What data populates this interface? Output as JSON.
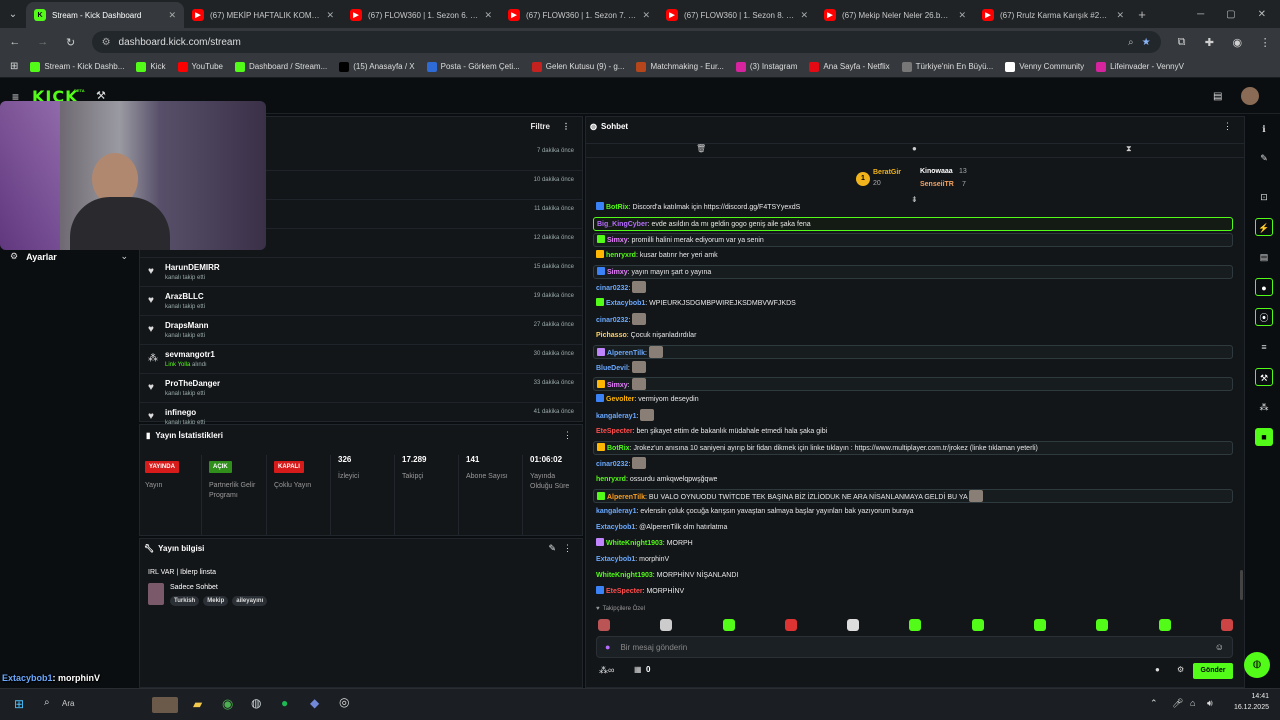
{
  "browser": {
    "tabs": [
      {
        "title": "Stream - Kick Dashboard",
        "icon": "kick-icon",
        "active": true
      },
      {
        "title": "(67) MEKİP HAFTALIK KOMİK AN",
        "icon": "youtube-icon"
      },
      {
        "title": "(67) FLOW360 | 1. Sezon 6. Bölü",
        "icon": "youtube-icon"
      },
      {
        "title": "(67) FLOW360 | 1. Sezon 7. Bölü",
        "icon": "youtube-icon"
      },
      {
        "title": "(67) FLOW360 | 1. Sezon 8. Bölü",
        "icon": "youtube-icon"
      },
      {
        "title": "(67) Mekip Neler Neler 26.bölüm",
        "icon": "youtube-icon"
      },
      {
        "title": "(67) Rrulz Karma Karışık #21 - Y",
        "icon": "youtube-icon"
      }
    ],
    "url": "dashboard.kick.com/stream",
    "bookmarks": [
      "Stream - Kick Dashb...",
      "Kick",
      "YouTube",
      "Dashboard / Stream...",
      "(15) Anasayfa / X",
      "Posta - Görkem Çeti...",
      "Gelen Kutusu (9) - g...",
      "Matchmaking - Eur...",
      "(3) Instagram",
      "Ana Sayfa - Netflix",
      "Türkiye'nin En Büyü...",
      "Venny Community",
      "Lifeinvader - VennyV"
    ]
  },
  "kick": {
    "logo": "KICK",
    "beta": "BETA"
  },
  "sidebar": {
    "settings": "Ayarlar"
  },
  "feed": {
    "filter": "Filtre",
    "rows": [
      {
        "time": "7 dakika önce"
      },
      {
        "time": "10 dakika önce"
      },
      {
        "time": "11 dakika önce"
      },
      {
        "time": "12 dakika önce"
      },
      {
        "name": "HarunDEMIRR",
        "sub": "kanalı takip etti",
        "time": "15 dakika önce"
      },
      {
        "name": "ArazBLLC",
        "sub": "kanalı takip etti",
        "time": "19 dakika önce"
      },
      {
        "name": "DrapsMann",
        "sub": "kanalı takip etti",
        "time": "27 dakika önce"
      },
      {
        "name": "sevmangotr1",
        "sub_link": "Link Yolla",
        "sub": "alındı",
        "time": "30 dakika önce"
      },
      {
        "name": "ProTheDanger",
        "sub": "kanalı takip etti",
        "time": "33 dakika önce"
      },
      {
        "name": "infinego",
        "sub": "kanalı takip etti",
        "time": "41 dakika önce"
      }
    ]
  },
  "stats": {
    "title": "Yayın İstatistikleri",
    "items": [
      {
        "badge": "YAYINDA",
        "badge_color": "#d71a1a",
        "label": "Yayın"
      },
      {
        "badge": "AÇIK",
        "badge_color": "#2f8f1a",
        "label": "Partnerlik Gelir Programı"
      },
      {
        "badge": "KAPALI",
        "badge_color": "#d71a1a",
        "label": "Çoklu Yayın"
      },
      {
        "value": "326",
        "label": "İzleyici"
      },
      {
        "value": "17.289",
        "label": "Takipçi"
      },
      {
        "value": "141",
        "label": "Abone Sayısı"
      },
      {
        "value": "01:06:02",
        "label": "Yayında Olduğu Süre"
      }
    ]
  },
  "info": {
    "title": "Yayın bilgisi",
    "stream_title": "IRL VAR | Iblerp linsta",
    "category": "Sadece Sohbet",
    "tags": [
      "Turkish",
      "Mekip",
      "aileyayını"
    ]
  },
  "chat": {
    "title": "Sohbet",
    "leaderboard": [
      {
        "name": "BeratGir",
        "count": "20"
      },
      {
        "name": "Kinowaaa",
        "count": "13"
      },
      {
        "name": "SenseiiTR",
        "count": "7"
      }
    ],
    "messages": [
      {
        "user": "BotRix",
        "color": "#53fc18",
        "text": ": Discord'a katılmak için https://discord.gg/F4TSYyexdS",
        "style": ""
      },
      {
        "user": "Big_KingCyber",
        "color": "#b66cff",
        "text": ": evde asıldın da mı geldin gogo geniş aile şaka fena",
        "style": "hlg"
      },
      {
        "user": "Simxy",
        "color": "#e880ff",
        "text": ": promilli halini merak ediyorum var ya senin",
        "style": "hl"
      },
      {
        "user": "henryxrd",
        "color": "#53fc18",
        "text": ": kusar batırır her yeri amk",
        "style": ""
      },
      {
        "user": "Simxy",
        "color": "#e880ff",
        "text": ": yayın mayın şart o yayına",
        "style": "hl"
      },
      {
        "user": "cinar0232",
        "color": "#6aa9ff",
        "text": ":",
        "style": "",
        "emote": true
      },
      {
        "user": "Extacybob1",
        "color": "#6aa9ff",
        "text": ": WPIEURKJSDGMBPWIREJKSDMBVWFJKDS",
        "style": ""
      },
      {
        "user": "cinar0232",
        "color": "#6aa9ff",
        "text": ":",
        "style": "",
        "emote": true
      },
      {
        "user": "Pichasso",
        "color": "#ffd166",
        "text": ": Çocuk nişanladırdılar",
        "style": ""
      },
      {
        "user": "AlperenTilk",
        "color": "#6aa9ff",
        "text": ":",
        "style": "hl",
        "emote": true
      },
      {
        "user": "BlueDevil",
        "color": "#6aa9ff",
        "text": ":",
        "style": "",
        "emote": true
      },
      {
        "user": "Simxy",
        "color": "#e880ff",
        "text": ":",
        "style": "hl",
        "emote": true
      },
      {
        "user": "Gevolter",
        "color": "#ffb703",
        "text": ": vermiyom deseydin",
        "style": ""
      },
      {
        "user": "kangaleray1",
        "color": "#6aa9ff",
        "text": ":",
        "style": "",
        "emote": true
      },
      {
        "user": "EteSpecter",
        "color": "#ff4d4d",
        "text": ": ben şikayet ettim de bakanlık müdahale etmedi hala şaka gibi",
        "style": ""
      },
      {
        "user": "BotRix",
        "color": "#53fc18",
        "text": ": Jrokez'un anısına 10 saniyeni ayırıp bir fidan dikmek için linke tıklayın : https://www.multiplayer.com.tr/jrokez (linke tıklaman yeterli)",
        "style": "hl"
      },
      {
        "user": "cinar0232",
        "color": "#6aa9ff",
        "text": ":",
        "style": "",
        "emote": true
      },
      {
        "user": "henryxrd",
        "color": "#53fc18",
        "text": ": ossurdu amkqwelqpwşğqwe",
        "style": ""
      },
      {
        "user": "AlperenTilk",
        "color": "#ff9f1c",
        "text": ": BU VALO OYNUODU TWİTCDE TEK BAŞINA BİZ İZLİODUK NE ARA NİSANLANMAYA GELDİ BU YA",
        "style": "hl",
        "emote": true
      },
      {
        "user": "kangaleray1",
        "color": "#6aa9ff",
        "text": ": evlensin çoluk çocuğa karışsın yavaştan salmaya başlar yayınları bak yazıyorum buraya",
        "style": ""
      },
      {
        "user": "Extacybob1",
        "color": "#6aa9ff",
        "text": ": @AlperenTilk olm hatırlatma",
        "style": ""
      },
      {
        "user": "WhiteKnight1903",
        "color": "#53fc18",
        "text": ": MORPH",
        "style": ""
      },
      {
        "user": "Extacybob1",
        "color": "#6aa9ff",
        "text": ": morphinV",
        "style": ""
      },
      {
        "user": "WhiteKnight1903",
        "color": "#53fc18",
        "text": ": MORPHİNV NİŞANLANDI",
        "style": ""
      },
      {
        "user": "EteSpecter",
        "color": "#ff4d4d",
        "text": ": MORPHİNV",
        "style": ""
      }
    ],
    "emote_tab": "Takipçilere Özel",
    "placeholder": "Bir mesaj gönderin",
    "points": "0",
    "send": "Gönder"
  },
  "overlay": {
    "lines": [
      {
        "user": "Extacybob1",
        "text": ": morphinV",
        "color": "#6aa9ff"
      },
      {
        "user": "WhiteKnight1903",
        "text": ": MORPHİNV NİŞANLANDI",
        "color": "#53fc18"
      },
      {
        "user": "EteSpecter",
        "text": ": MORPHİNV",
        "color": "#ff4d4d"
      }
    ]
  },
  "taskbar": {
    "search": "Ara",
    "time": "14:41",
    "date": "16.12.2025"
  }
}
